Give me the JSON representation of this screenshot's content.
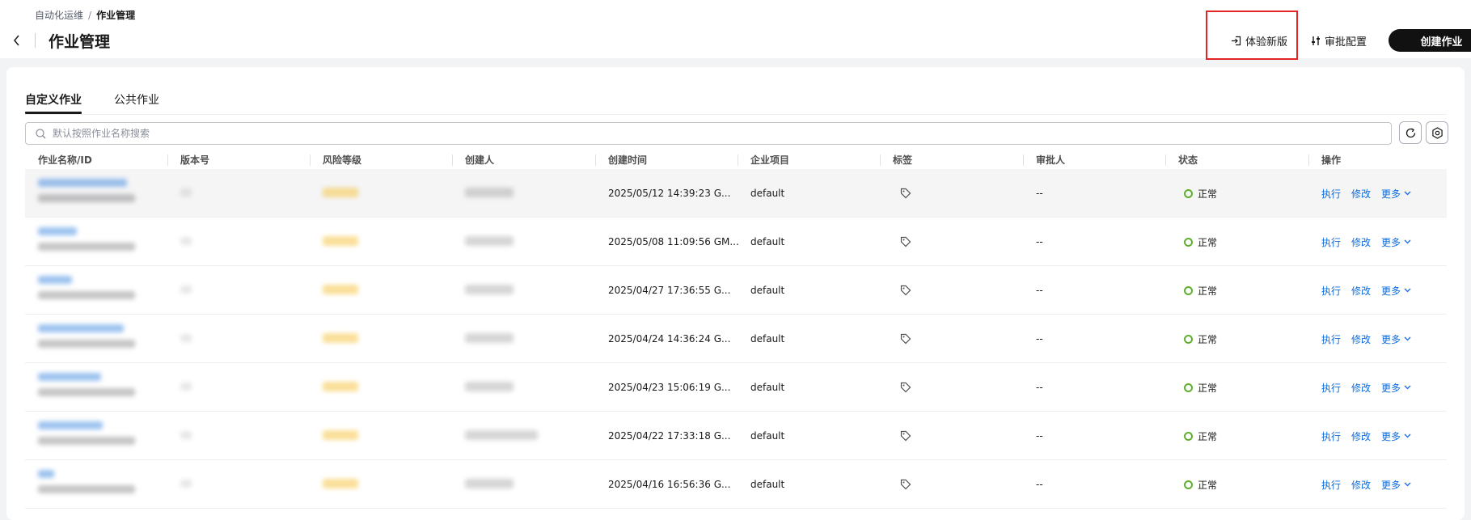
{
  "breadcrumb": {
    "parent": "自动化运维",
    "separator": "/",
    "current": "作业管理"
  },
  "header": {
    "title": "作业管理",
    "try_new_label": "体验新版",
    "approval_label": "审批配置",
    "create_label": "创建作业"
  },
  "tabs": [
    {
      "label": "自定义作业",
      "active": true
    },
    {
      "label": "公共作业",
      "active": false
    }
  ],
  "search": {
    "placeholder": "默认按照作业名称搜索",
    "value": ""
  },
  "columns": [
    "作业名称/ID",
    "版本号",
    "风险等级",
    "创建人",
    "创建时间",
    "企业项目",
    "标签",
    "审批人",
    "状态",
    "操作"
  ],
  "rows": [
    {
      "created": "2025/05/12 14:39:23 G...",
      "project": "default",
      "approver": "--",
      "status": "正常"
    },
    {
      "created": "2025/05/08 11:09:56 GM...",
      "project": "default",
      "approver": "--",
      "status": "正常"
    },
    {
      "created": "2025/04/27 17:36:55 G...",
      "project": "default",
      "approver": "--",
      "status": "正常"
    },
    {
      "created": "2025/04/24 14:36:24 G...",
      "project": "default",
      "approver": "--",
      "status": "正常"
    },
    {
      "created": "2025/04/23 15:06:19 G...",
      "project": "default",
      "approver": "--",
      "status": "正常"
    },
    {
      "created": "2025/04/22 17:33:18 G...",
      "project": "default",
      "approver": "--",
      "status": "正常"
    },
    {
      "created": "2025/04/16 16:56:36 G...",
      "project": "default",
      "approver": "--",
      "status": "正常"
    }
  ],
  "actions": {
    "execute": "执行",
    "modify": "修改",
    "more": "更多"
  },
  "colors": {
    "link": "#0d6de0",
    "status_ok": "#5faf2d",
    "primary_button": "#111111",
    "highlight_box": "#e32424",
    "risk_blur": "#f6c544",
    "id_blur": "#4a90e2"
  },
  "icons": {
    "back": "chevron-left-icon",
    "try_new": "login-arrow-icon",
    "approval": "sliders-icon",
    "search": "search-icon",
    "refresh": "refresh-icon",
    "settings": "gear-icon",
    "tag": "tag-icon",
    "more": "chevron-down-icon"
  }
}
